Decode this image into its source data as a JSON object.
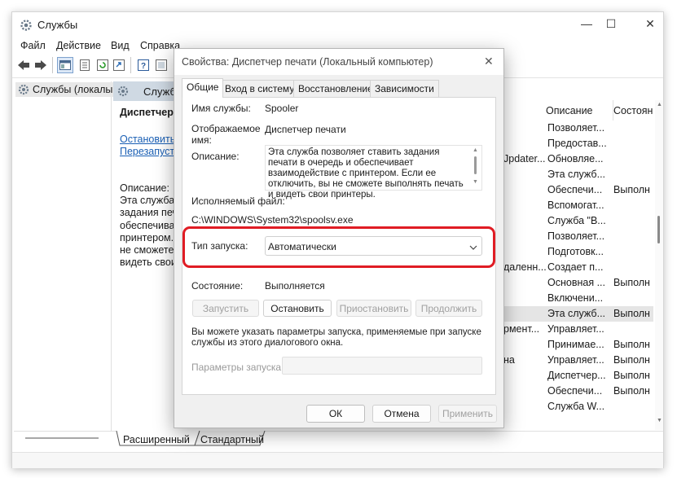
{
  "window": {
    "title": "Службы",
    "minimize": "—",
    "maximize": "☐",
    "close": "✕"
  },
  "menu": [
    "Файл",
    "Действие",
    "Вид",
    "Справка"
  ],
  "tree": {
    "root_label": "Службы (локалы"
  },
  "panel": {
    "header": "Службы",
    "service_name": "Диспетчер п",
    "link_stop": "Остановить",
    "link_restart": "Перезапусти",
    "desc_lines": [
      "Описание:",
      "Эта служба п",
      "задания печа",
      "обеспечивае",
      "принтером.",
      "не сможете",
      "видеть свои"
    ]
  },
  "list": {
    "col_description": "Описание",
    "col_status": "Состоян",
    "rows": [
      {
        "name": "",
        "desc": "Позволяет...",
        "status": ""
      },
      {
        "name": "",
        "desc": "Предостав...",
        "status": ""
      },
      {
        "name": "Jpdater...",
        "desc": "Обновляе...",
        "status": ""
      },
      {
        "name": "",
        "desc": "Эта служб...",
        "status": ""
      },
      {
        "name": "",
        "desc": "Обеспечи...",
        "status": "Выполн"
      },
      {
        "name": "",
        "desc": "Вспомогат...",
        "status": ""
      },
      {
        "name": "",
        "desc": "Служба \"В...",
        "status": ""
      },
      {
        "name": "",
        "desc": "Позволяет...",
        "status": ""
      },
      {
        "name": "",
        "desc": "Подготовк...",
        "status": ""
      },
      {
        "name": "даленн...",
        "desc": "Создает п...",
        "status": ""
      },
      {
        "name": "",
        "desc": "Основная ...",
        "status": "Выполн"
      },
      {
        "name": "",
        "desc": "Включени...",
        "status": ""
      },
      {
        "name": "",
        "desc": "Эта служб...",
        "status": "Выполн"
      },
      {
        "name": "рмент...",
        "desc": "Управляет...",
        "status": ""
      },
      {
        "name": "",
        "desc": "Принимае...",
        "status": "Выполн"
      },
      {
        "name": "на",
        "desc": "Управляет...",
        "status": "Выполн"
      },
      {
        "name": "",
        "desc": "Диспетчер...",
        "status": "Выполн"
      },
      {
        "name": "",
        "desc": "Обеспечи...",
        "status": "Выполн"
      },
      {
        "name": "",
        "desc": "Служба W...",
        "status": ""
      }
    ]
  },
  "bottom_tabs": {
    "extended": "Расширенный",
    "standard": "Стандартный"
  },
  "dialog": {
    "title": "Свойства: Диспетчер печати (Локальный компьютер)",
    "close": "✕",
    "tabs": [
      "Общие",
      "Вход в систему",
      "Восстановление",
      "Зависимости"
    ],
    "service_name_label": "Имя службы:",
    "service_name_value": "Spooler",
    "display_name_label_1": "Отображаемое",
    "display_name_label_2": "имя:",
    "display_name_value": "Диспетчер печати",
    "description_label": "Описание:",
    "description_text": "Эта служба позволяет ставить задания печати в очередь и обеспечивает взаимодействие с принтером.  Если ее отключить, вы не сможете выполнять печать и видеть свои принтеры.",
    "exe_label": "Исполняемый файл:",
    "exe_path": "C:\\WINDOWS\\System32\\spoolsv.exe",
    "startup_label": "Тип запуска:",
    "startup_value": "Автоматически",
    "status_label": "Состояние:",
    "status_value": "Выполняется",
    "btn_start": "Запустить",
    "btn_stop": "Остановить",
    "btn_pause": "Приостановить",
    "btn_resume": "Продолжить",
    "hint_text": "Вы можете указать параметры запуска, применяемые при запуске службы из этого диалогового окна.",
    "params_label": "Параметры запуска:",
    "params_value": "",
    "btn_ok": "ОК",
    "btn_cancel": "Отмена",
    "btn_apply": "Применить"
  },
  "colors": {
    "highlight": "#e01c24",
    "accent": "#1a5fb4"
  }
}
